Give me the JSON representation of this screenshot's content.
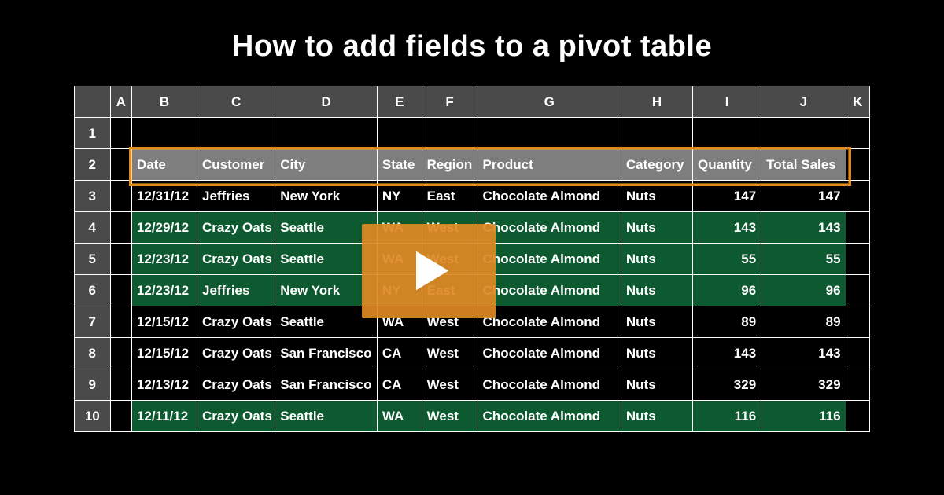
{
  "title": "How to add fields to a pivot table",
  "columns": [
    "A",
    "B",
    "C",
    "D",
    "E",
    "F",
    "G",
    "H",
    "I",
    "J",
    "K"
  ],
  "rowNumbers": [
    "1",
    "2",
    "3",
    "4",
    "5",
    "6",
    "7",
    "8",
    "9",
    "10"
  ],
  "fieldHeaders": [
    "Date",
    "Customer",
    "City",
    "State",
    "Region",
    "Product",
    "Category",
    "Quantity",
    "Total Sales"
  ],
  "rows": [
    {
      "date": "12/31/12",
      "customer": "Jeffries",
      "city": "New York",
      "state": "NY",
      "region": "East",
      "product": "Chocolate Almond",
      "category": "Nuts",
      "quantity": "147",
      "total": "147",
      "band": false
    },
    {
      "date": "12/29/12",
      "customer": "Crazy Oats",
      "city": "Seattle",
      "state": "WA",
      "region": "West",
      "product": "Chocolate Almond",
      "category": "Nuts",
      "quantity": "143",
      "total": "143",
      "band": true
    },
    {
      "date": "12/23/12",
      "customer": "Crazy Oats",
      "city": "Seattle",
      "state": "WA",
      "region": "West",
      "product": "Chocolate Almond",
      "category": "Nuts",
      "quantity": "55",
      "total": "55",
      "band": true
    },
    {
      "date": "12/23/12",
      "customer": "Jeffries",
      "city": "New York",
      "state": "NY",
      "region": "East",
      "product": "Chocolate Almond",
      "category": "Nuts",
      "quantity": "96",
      "total": "96",
      "band": true
    },
    {
      "date": "12/15/12",
      "customer": "Crazy Oats",
      "city": "Seattle",
      "state": "WA",
      "region": "West",
      "product": "Chocolate Almond",
      "category": "Nuts",
      "quantity": "89",
      "total": "89",
      "band": false
    },
    {
      "date": "12/15/12",
      "customer": "Crazy Oats",
      "city": "San Francisco",
      "state": "CA",
      "region": "West",
      "product": "Chocolate Almond",
      "category": "Nuts",
      "quantity": "143",
      "total": "143",
      "band": false
    },
    {
      "date": "12/13/12",
      "customer": "Crazy Oats",
      "city": "San Francisco",
      "state": "CA",
      "region": "West",
      "product": "Chocolate Almond",
      "category": "Nuts",
      "quantity": "329",
      "total": "329",
      "band": false
    },
    {
      "date": "12/11/12",
      "customer": "Crazy Oats",
      "city": "Seattle",
      "state": "WA",
      "region": "West",
      "product": "Chocolate Almond",
      "category": "Nuts",
      "quantity": "116",
      "total": "116",
      "band": true
    }
  ],
  "playLabel": "play-video"
}
